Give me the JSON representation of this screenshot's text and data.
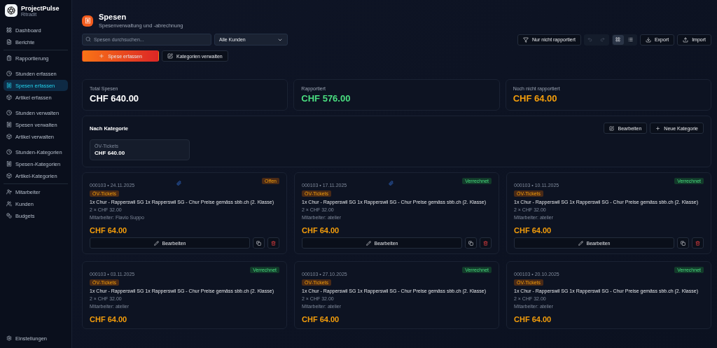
{
  "app": {
    "name": "ProjectPulse",
    "subtitle": "Ritradit"
  },
  "sidebar": {
    "groups": [
      [
        {
          "label": "Dashboard",
          "selected": false
        },
        {
          "label": "Berichte",
          "selected": false
        }
      ],
      [
        {
          "label": "Rapportierung",
          "selected": false
        }
      ],
      [
        {
          "label": "Stunden erfassen",
          "selected": false
        },
        {
          "label": "Spesen erfassen",
          "selected": true
        },
        {
          "label": "Artikel erfassen",
          "selected": false
        }
      ],
      [
        {
          "label": "Stunden verwalten",
          "selected": false
        },
        {
          "label": "Spesen verwalten",
          "selected": false
        },
        {
          "label": "Artikel verwalten",
          "selected": false
        }
      ],
      [
        {
          "label": "Stunden-Kategorien",
          "selected": false
        },
        {
          "label": "Spesen-Kategorien",
          "selected": false
        },
        {
          "label": "Artikel-Kategorien",
          "selected": false
        }
      ],
      [
        {
          "label": "Mitarbeiter",
          "selected": false
        },
        {
          "label": "Kunden",
          "selected": false
        },
        {
          "label": "Budgets",
          "selected": false
        }
      ]
    ],
    "footer": {
      "label": "Einstellungen"
    }
  },
  "header": {
    "title": "Spesen",
    "subtitle": "Spesenverwaltung und -abrechnung"
  },
  "search": {
    "placeholder": "Spesen durchsuchen..."
  },
  "customer_select": {
    "value": "Alle Kunden"
  },
  "actions": {
    "primary": "Spese erfassen",
    "secondary": "Kategorien verwalten"
  },
  "toolbar": {
    "filter": "Nur nicht rapportiert",
    "undo_disabled": true,
    "redo_disabled": true,
    "views": [
      {
        "kind": "grid",
        "selected": true
      },
      {
        "kind": "list",
        "selected": false
      }
    ],
    "export": "Export",
    "import": "Import"
  },
  "summary": [
    {
      "label": "Total Spesen",
      "value": "CHF 640.00",
      "kind": "total"
    },
    {
      "label": "Rapportiert",
      "value": "CHF 576.00",
      "kind": "done"
    },
    {
      "label": "Noch nicht rapportiert",
      "value": "CHF 64.00",
      "kind": "open"
    }
  ],
  "categories": {
    "title": "Nach Kategorie",
    "edit": "Bearbeiten",
    "new": "Neue Kategorie",
    "items": [
      {
        "name": "ÖV-Tickets",
        "amount": "CHF 640.00"
      }
    ]
  },
  "expenses": [
    {
      "status": "Offen",
      "kind": "open",
      "meta": "000103 • 24.11.2025",
      "attachment": true,
      "category": "ÖV-Tickets",
      "description": "1x Chur - Rapperswil SG 1x Rapperswil SG - Chur Preise gemäss sbb.ch (2. Klasse)",
      "quantity": "2 × CHF 32.00",
      "employee": "Mitarbeiter: Flavio Suppo",
      "amount": "CHF 64.00",
      "edit": "Bearbeiten"
    },
    {
      "status": "Verrechnet",
      "kind": "billed",
      "meta": "000103 • 17.11.2025",
      "attachment": true,
      "category": "ÖV-Tickets",
      "description": "1x Chur - Rapperswil SG 1x Rapperswil SG - Chur Preise gemäss sbb.ch (2. Klasse)",
      "quantity": "2 × CHF 32.00",
      "employee": "Mitarbeiter: atelier",
      "amount": "CHF 64.00",
      "edit": "Bearbeiten"
    },
    {
      "status": "Verrechnet",
      "kind": "billed",
      "meta": "000103 • 10.11.2025",
      "attachment": false,
      "category": "ÖV-Tickets",
      "description": "1x Chur - Rapperswil SG 1x Rapperswil SG - Chur Preise gemäss sbb.ch (2. Klasse)",
      "quantity": "2 × CHF 32.00",
      "employee": "Mitarbeiter: atelier",
      "amount": "CHF 64.00",
      "edit": "Bearbeiten"
    },
    {
      "status": "Verrechnet",
      "kind": "billed",
      "meta": "000103 • 03.11.2025",
      "attachment": false,
      "category": "ÖV-Tickets",
      "description": "1x Chur - Rapperswil SG 1x Rapperswil SG - Chur Preise gemäss sbb.ch (2. Klasse)",
      "quantity": "2 × CHF 32.00",
      "employee": "Mitarbeiter: atelier",
      "amount": "CHF 64.00"
    },
    {
      "status": "Verrechnet",
      "kind": "billed",
      "meta": "000103 • 27.10.2025",
      "attachment": false,
      "category": "ÖV-Tickets",
      "description": "1x Chur - Rapperswil SG 1x Rapperswil SG - Chur Preise gemäss sbb.ch (2. Klasse)",
      "quantity": "2 × CHF 32.00",
      "employee": "Mitarbeiter: atelier",
      "amount": "CHF 64.00"
    },
    {
      "status": "Verrechnet",
      "kind": "billed",
      "meta": "000103 • 20.10.2025",
      "attachment": false,
      "category": "ÖV-Tickets",
      "description": "1x Chur - Rapperswil SG 1x Rapperswil SG - Chur Preise gemäss sbb.ch (2. Klasse)",
      "quantity": "2 × CHF 32.00",
      "employee": "Mitarbeiter: atelier",
      "amount": "CHF 64.00"
    }
  ]
}
